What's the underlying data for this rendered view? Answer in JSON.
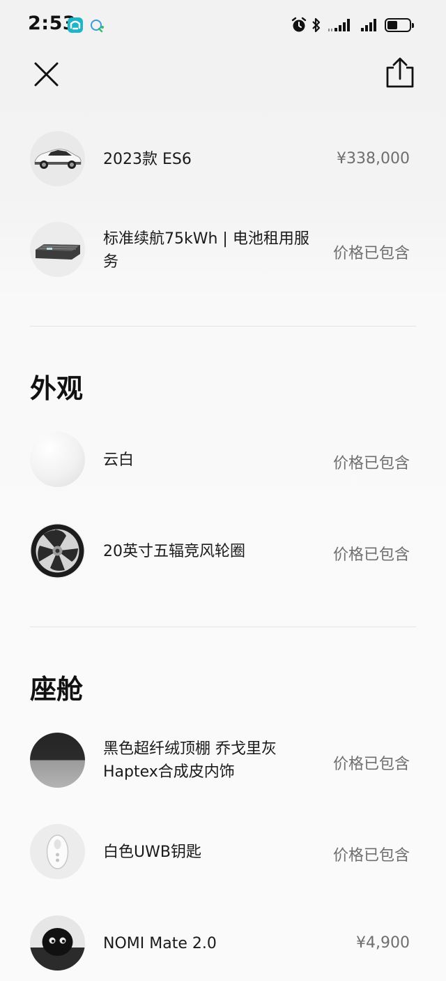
{
  "status_bar": {
    "time": "2:53"
  },
  "top_items": [
    {
      "name": "2023款 ES6",
      "price": "¥338,000",
      "thumb_icon": "car-icon"
    },
    {
      "name": "标准续航75kWh | 电池租用服务",
      "price": "价格已包含",
      "thumb_icon": "battery-pack-icon"
    }
  ],
  "sections": [
    {
      "title": "外观",
      "items": [
        {
          "name": "云白",
          "price": "价格已包含",
          "thumb_icon": "white-swatch-icon"
        },
        {
          "name": "20英寸五辐竞风轮圈",
          "price": "价格已包含",
          "thumb_icon": "wheel-icon"
        }
      ]
    },
    {
      "title": "座舱",
      "items": [
        {
          "name": "黑色超纤绒顶棚 乔戈里灰Haptex合成皮内饰",
          "price": "价格已包含",
          "thumb_icon": "interior-swatch-icon"
        },
        {
          "name": "白色UWB钥匙",
          "price": "价格已包含",
          "thumb_icon": "key-fob-icon"
        },
        {
          "name": "NOMI Mate 2.0",
          "price": "¥4,900",
          "thumb_icon": "nomi-robot-icon"
        }
      ]
    }
  ],
  "colors": {
    "accent_app": "#1fb5c8",
    "text_primary": "#1a1a1a",
    "text_secondary": "#6e6e6e",
    "divider": "#e3e3e3"
  }
}
